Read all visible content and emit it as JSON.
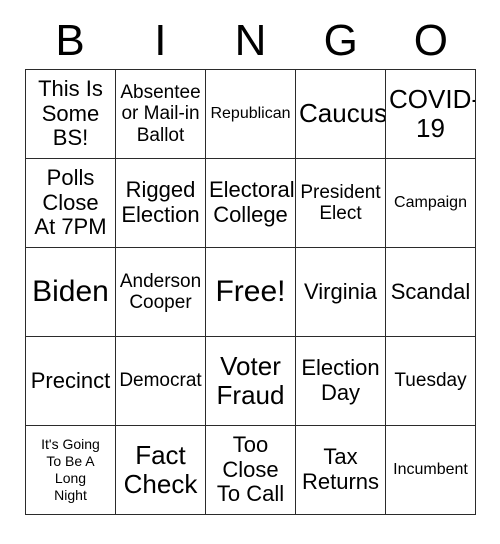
{
  "header": {
    "letters": [
      "B",
      "I",
      "N",
      "G",
      "O"
    ]
  },
  "colors": {
    "background": "#ffffff",
    "text": "#000000",
    "grid_line": "#2b2b2b"
  },
  "grid": {
    "rows": 5,
    "columns": 5,
    "free_space": "Free!",
    "cells": [
      [
        {
          "text": "This Is\nSome\nBS!",
          "size": "lg"
        },
        {
          "text": "Absentee\nor Mail-in\nBallot",
          "size": "md"
        },
        {
          "text": "Republican",
          "size": "sm"
        },
        {
          "text": "Caucus",
          "size": "xl"
        },
        {
          "text": "COVID-\n19",
          "size": "xl"
        }
      ],
      [
        {
          "text": "Polls\nClose\nAt 7PM",
          "size": "lg"
        },
        {
          "text": "Rigged\nElection",
          "size": "lg"
        },
        {
          "text": "Electoral\nCollege",
          "size": "lg"
        },
        {
          "text": "President\nElect",
          "size": "md"
        },
        {
          "text": "Campaign",
          "size": "sm"
        }
      ],
      [
        {
          "text": "Biden",
          "size": "xxl"
        },
        {
          "text": "Anderson\nCooper",
          "size": "md"
        },
        {
          "text": "Free!",
          "size": "xxl"
        },
        {
          "text": "Virginia",
          "size": "lg"
        },
        {
          "text": "Scandal",
          "size": "lg"
        }
      ],
      [
        {
          "text": "Precinct",
          "size": "lg"
        },
        {
          "text": "Democrat",
          "size": "md"
        },
        {
          "text": "Voter\nFraud",
          "size": "xl"
        },
        {
          "text": "Election\nDay",
          "size": "lg"
        },
        {
          "text": "Tuesday",
          "size": "md"
        }
      ],
      [
        {
          "text": "It's Going\nTo Be A\nLong\nNight",
          "size": "xs"
        },
        {
          "text": "Fact\nCheck",
          "size": "xl"
        },
        {
          "text": "Too\nClose\nTo Call",
          "size": "lg"
        },
        {
          "text": "Tax\nReturns",
          "size": "lg"
        },
        {
          "text": "Incumbent",
          "size": "sm"
        }
      ]
    ]
  }
}
